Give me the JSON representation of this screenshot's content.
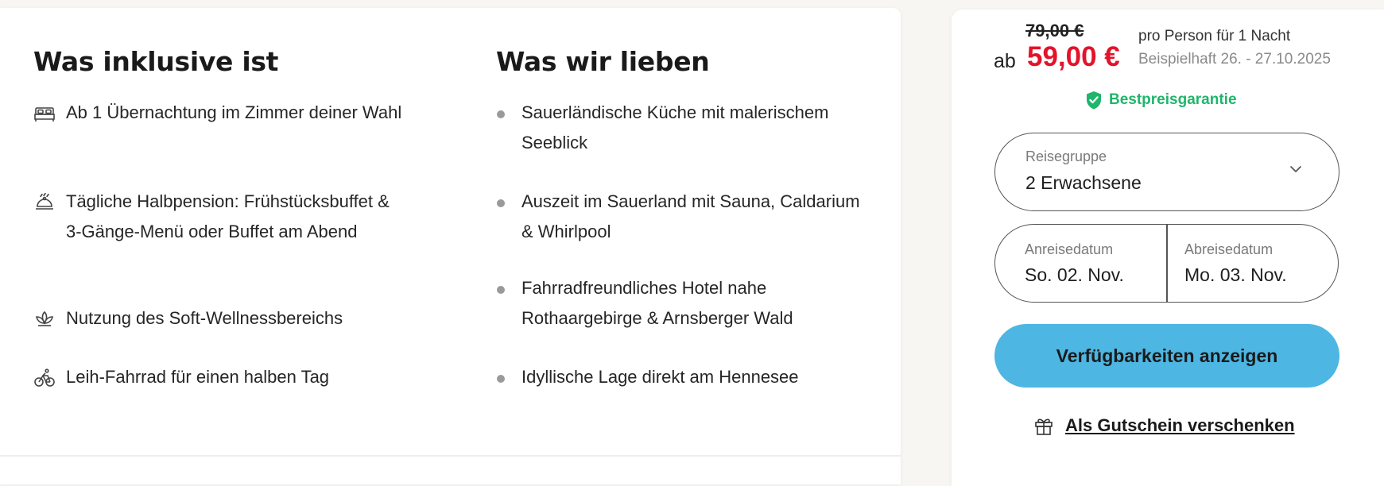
{
  "included": {
    "title": "Was inklusive ist",
    "items": [
      {
        "icon": "bed-icon",
        "text": "Ab 1 Übernachtung im Zimmer deiner Wahl"
      },
      {
        "icon": "dining-icon",
        "text": "Tägliche Halbpension: Frühstücksbuffet & 3-Gänge-Menü oder Buffet am Abend"
      },
      {
        "icon": "lotus-icon",
        "text": "Nutzung des Soft-Wellnessbereichs"
      },
      {
        "icon": "bicycle-icon",
        "text": "Leih-Fahrrad für einen halben Tag"
      }
    ]
  },
  "loved": {
    "title": "Was wir lieben",
    "items": [
      {
        "text": "Sauerländische Küche mit malerischem Seeblick"
      },
      {
        "text": "Auszeit im Sauerland mit Sauna, Caldarium & Whirlpool"
      },
      {
        "text": "Fahrradfreundliches Hotel nahe Rothaargebirge & Arnsberger Wald"
      },
      {
        "text": "Idyllische Lage direkt am Hennesee"
      }
    ]
  },
  "booking": {
    "old_price": "79,00 €",
    "ab_label": "ab",
    "price": "59,00 €",
    "price_note": "pro Person für 1 Nacht",
    "price_dates": "Beispielhaft 26. - 27.10.2025",
    "guarantee": "Bestpreisgarantie",
    "group": {
      "label": "Reisegruppe",
      "value": "2 Erwachsene"
    },
    "arrival": {
      "label": "Anreisedatum",
      "value": "So. 02. Nov."
    },
    "departure": {
      "label": "Abreisedatum",
      "value": "Mo. 03. Nov."
    },
    "cta_label": "Verfügbarkeiten anzeigen",
    "gift_label": "Als Gutschein verschenken"
  },
  "colors": {
    "price_red": "#e4132a",
    "guarantee_green": "#1fb56b",
    "cta_blue": "#4db6e3",
    "bullet_gray": "#9a9a9a"
  }
}
